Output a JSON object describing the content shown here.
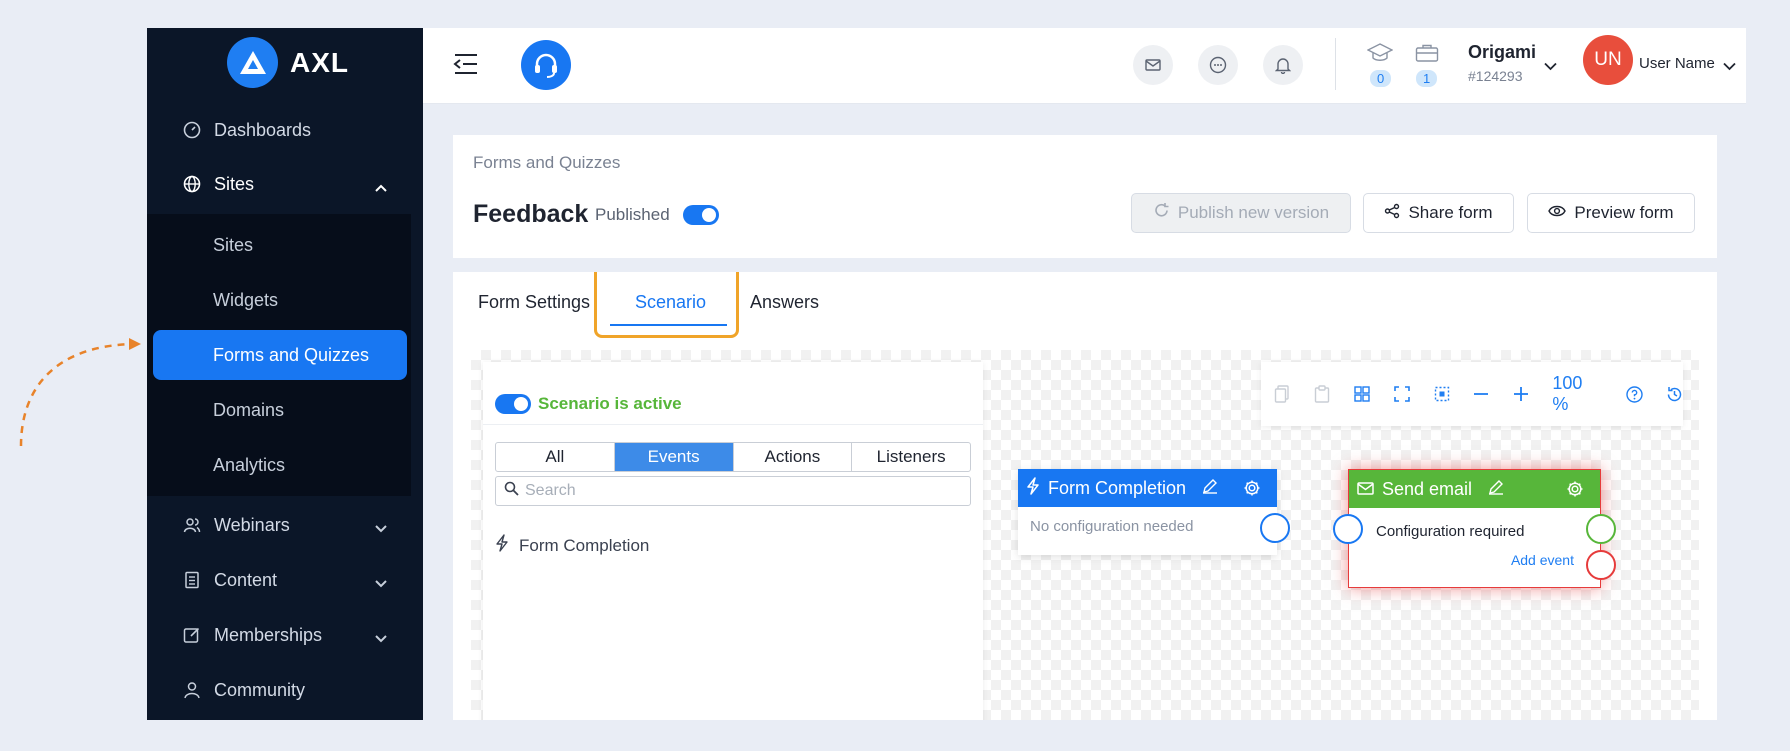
{
  "sidebar": {
    "brand": "AXL",
    "items": [
      {
        "label": "Dashboards",
        "icon": "gauge-icon"
      },
      {
        "label": "Sites",
        "icon": "globe-icon"
      },
      {
        "label": "Webinars",
        "icon": "people-icon"
      },
      {
        "label": "Content",
        "icon": "book-icon"
      },
      {
        "label": "Memberships",
        "icon": "edit-icon"
      },
      {
        "label": "Community",
        "icon": "user-icon"
      }
    ],
    "sub_items": [
      {
        "label": "Sites"
      },
      {
        "label": "Widgets"
      },
      {
        "label": "Forms and Quizzes",
        "active": true
      },
      {
        "label": "Domains"
      },
      {
        "label": "Analytics"
      }
    ]
  },
  "topbar": {
    "courses_count": "0",
    "briefcase_count": "1",
    "org_name": "Origami",
    "org_id": "#124293",
    "avatar_initials": "UN",
    "user_name": "User Name"
  },
  "header": {
    "breadcrumb": "Forms and Quizzes",
    "title": "Feedback",
    "published_label": "Published",
    "publish_button": "Publish new version",
    "share_button": "Share form",
    "preview_button": "Preview form"
  },
  "tabs": [
    {
      "label": "Form Settings"
    },
    {
      "label": "Scenario",
      "active": true
    },
    {
      "label": "Answers"
    }
  ],
  "scenario": {
    "active_label": "Scenario is active",
    "filters": [
      "All",
      "Events",
      "Actions",
      "Listeners"
    ],
    "active_filter": "Events",
    "search_placeholder": "Search",
    "list": [
      "Form Completion"
    ]
  },
  "toolbar": {
    "zoom": "100 %"
  },
  "nodes": {
    "form_completion": {
      "title": "Form Completion",
      "body": "No configuration needed"
    },
    "send_email": {
      "title": "Send email",
      "body": "Configuration required",
      "link": "Add event"
    }
  },
  "colors": {
    "sidebar_bg": "#0b1628",
    "accent": "#1877f2",
    "success": "#57b63a",
    "error": "#e63b3b",
    "highlight": "#f0a429"
  }
}
